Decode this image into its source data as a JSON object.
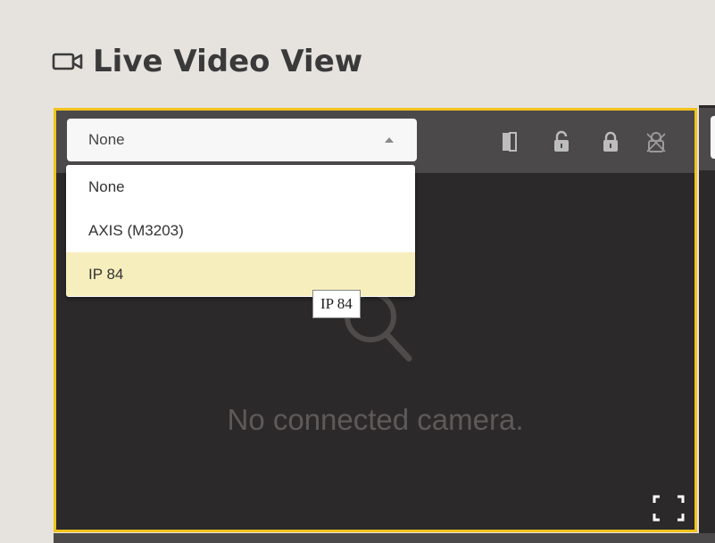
{
  "page": {
    "title": "Live Video View"
  },
  "camera_select": {
    "value": "None",
    "options": [
      "None",
      "AXIS (M3203)",
      "IP 84"
    ],
    "highlighted": "IP 84"
  },
  "tooltip": {
    "text": "IP 84"
  },
  "viewer": {
    "empty_message": "No connected camera."
  },
  "toolbar_icons": [
    "door-icon",
    "unlock-icon",
    "lock-icon",
    "lockdown-icon"
  ],
  "colors": {
    "accent": "#f2c31c",
    "highlight": "#f6eebd",
    "viewer_bg": "#2b2929",
    "toolbar_bg": "#4b4949"
  }
}
